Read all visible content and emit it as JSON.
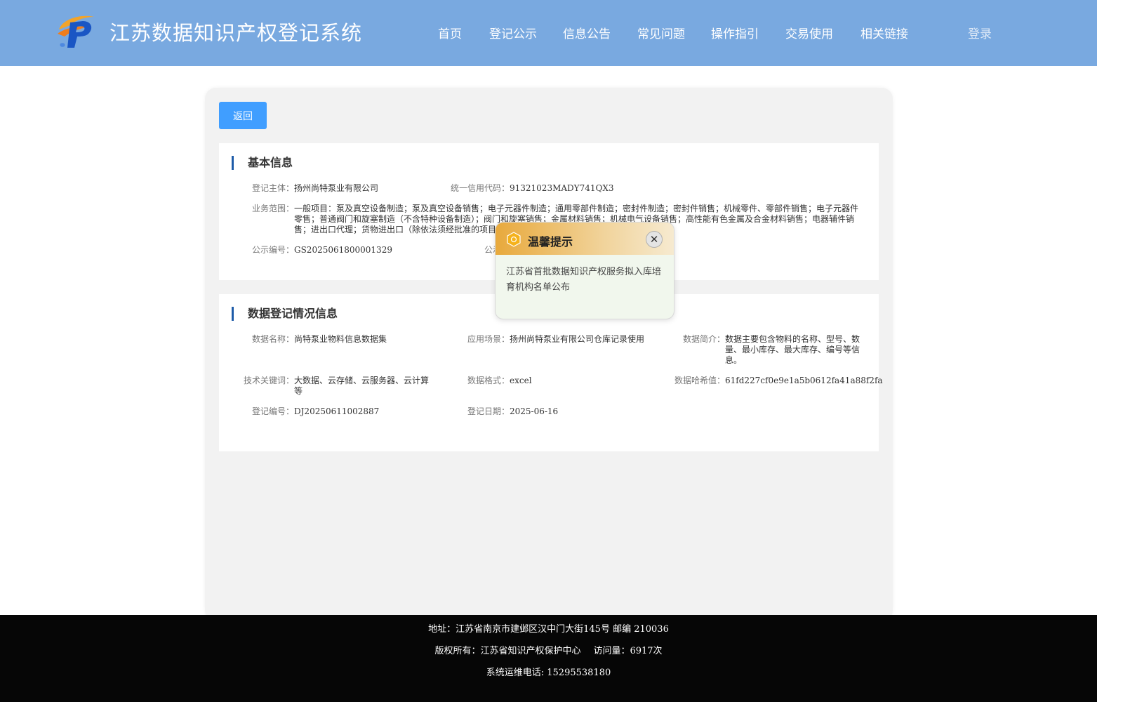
{
  "header": {
    "title": "江苏数据知识产权登记系统",
    "nav": [
      "首页",
      "登记公示",
      "信息公告",
      "常见问题",
      "操作指引",
      "交易使用",
      "相关链接"
    ],
    "login": "登录",
    "logo_icon": "ip-logo-icon"
  },
  "back_label": "返回",
  "basic": {
    "title": "基本信息",
    "subject_label": "登记主体：",
    "subject": "扬州尚特泵业有限公司",
    "credit_label": "统一信用代码：",
    "credit": "91321023MADY741QX3",
    "scope_label": "业务范围：",
    "scope": "一般项目：泵及真空设备制造；泵及真空设备销售；电子元器件制造；通用零部件制造；密封件制造；密封件销售；机械零件、零部件销售；电子元器件零售；普通阀门和旋塞制造（不含特种设备制造）；阀门和旋塞销售；金属材料销售；机械电气设备销售；高性能有色金属及合金材料销售；电器辅件销售；进出口代理；货物进出口（除依法须经批准的项目外，凭营业执照依法自主开展经营活动）",
    "notice_no_label": "公示编号：",
    "notice_no": "GS2025061800001329",
    "notice_time_label": "公示时"
  },
  "registration": {
    "title": "数据登记情况信息",
    "name_label": "数据名称：",
    "name": "尚特泵业物料信息数据集",
    "scenario_label": "应用场景：",
    "scenario": "扬州尚特泵业有限公司仓库记录使用",
    "intro_label": "数据简介：",
    "intro": "数据主要包含物料的名称、型号、数量、最小库存、最大库存、编号等信息。",
    "keywords_label": "技术关键词：",
    "keywords": "大数据、云存储、云服务器、云计算等",
    "format_label": "数据格式：",
    "format": "excel",
    "hash_label": "数据哈希值：",
    "hash": "61fd227cf0e9e1a5b0612fa41a88f2fa",
    "reg_no_label": "登记编号：",
    "reg_no": "DJ20250611002887",
    "reg_date_label": "登记日期：",
    "reg_date": "2025-06-16"
  },
  "popup": {
    "title": "温馨提示",
    "body": "江苏省首批数据知识产权服务拟入库培育机构名单公布",
    "close": "✕",
    "icon": "bell-badge-icon"
  },
  "footer": {
    "address": "地址：江苏省南京市建邺区汉中门大街145号 邮编 210036",
    "copyright": "版权所有：江苏省知识产权保护中心",
    "visits": "访问量：6917次",
    "phone": "系统运维电话: 15295538180"
  },
  "colors": {
    "header_bg": "#79a9e0",
    "button_blue": "#409eff",
    "section_bar": "#1e5ba8",
    "footer_bg": "#060606",
    "popup_head_start": "#e8a93c"
  }
}
